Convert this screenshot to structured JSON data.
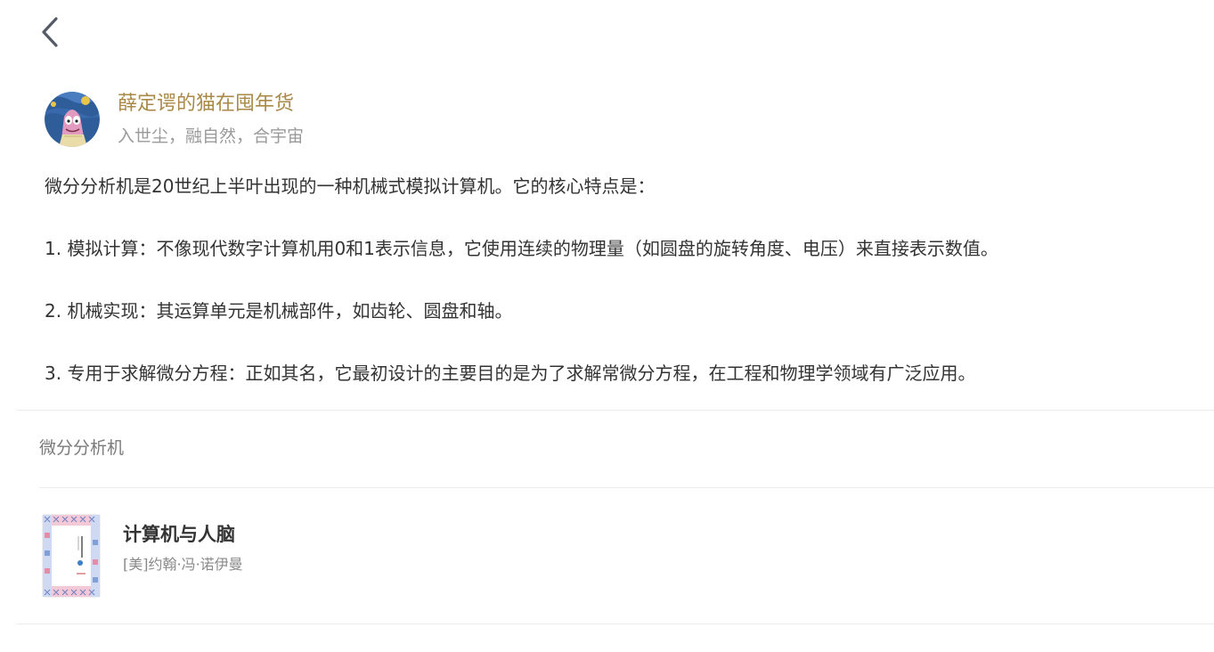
{
  "nav": {
    "back_icon": "chevron-left-icon"
  },
  "author": {
    "name": "薛定谔的猫在囤年货",
    "motto": "入世尘，融自然，合宇宙",
    "avatar_icon": "avatar-cartoon-starfish"
  },
  "content": {
    "paragraphs": [
      "微分分析机是20世纪上半叶出现的一种机械式模拟计算机。它的核心特点是：",
      "1. 模拟计算：不像现代数字计算机用0和1表示信息，它使用连续的物理量（如圆盘的旋转角度、电压）来直接表示数值。",
      "2. 机械实现：其运算单元是机械部件，如齿轮、圆盘和轴。",
      "3. 专用于求解微分方程：正如其名，它最初设计的主要目的是为了求解常微分方程，在工程和物理学领域有广泛应用。"
    ]
  },
  "topic": {
    "label": "微分分析机"
  },
  "book": {
    "title": "计算机与人脑",
    "author": "[美]约翰·冯·诺伊曼",
    "cover_icon": "book-cover-image"
  },
  "colors": {
    "author_name": "#a98947",
    "muted_text": "#9a9a9a",
    "body_text": "#333333",
    "divider": "#ececec"
  }
}
